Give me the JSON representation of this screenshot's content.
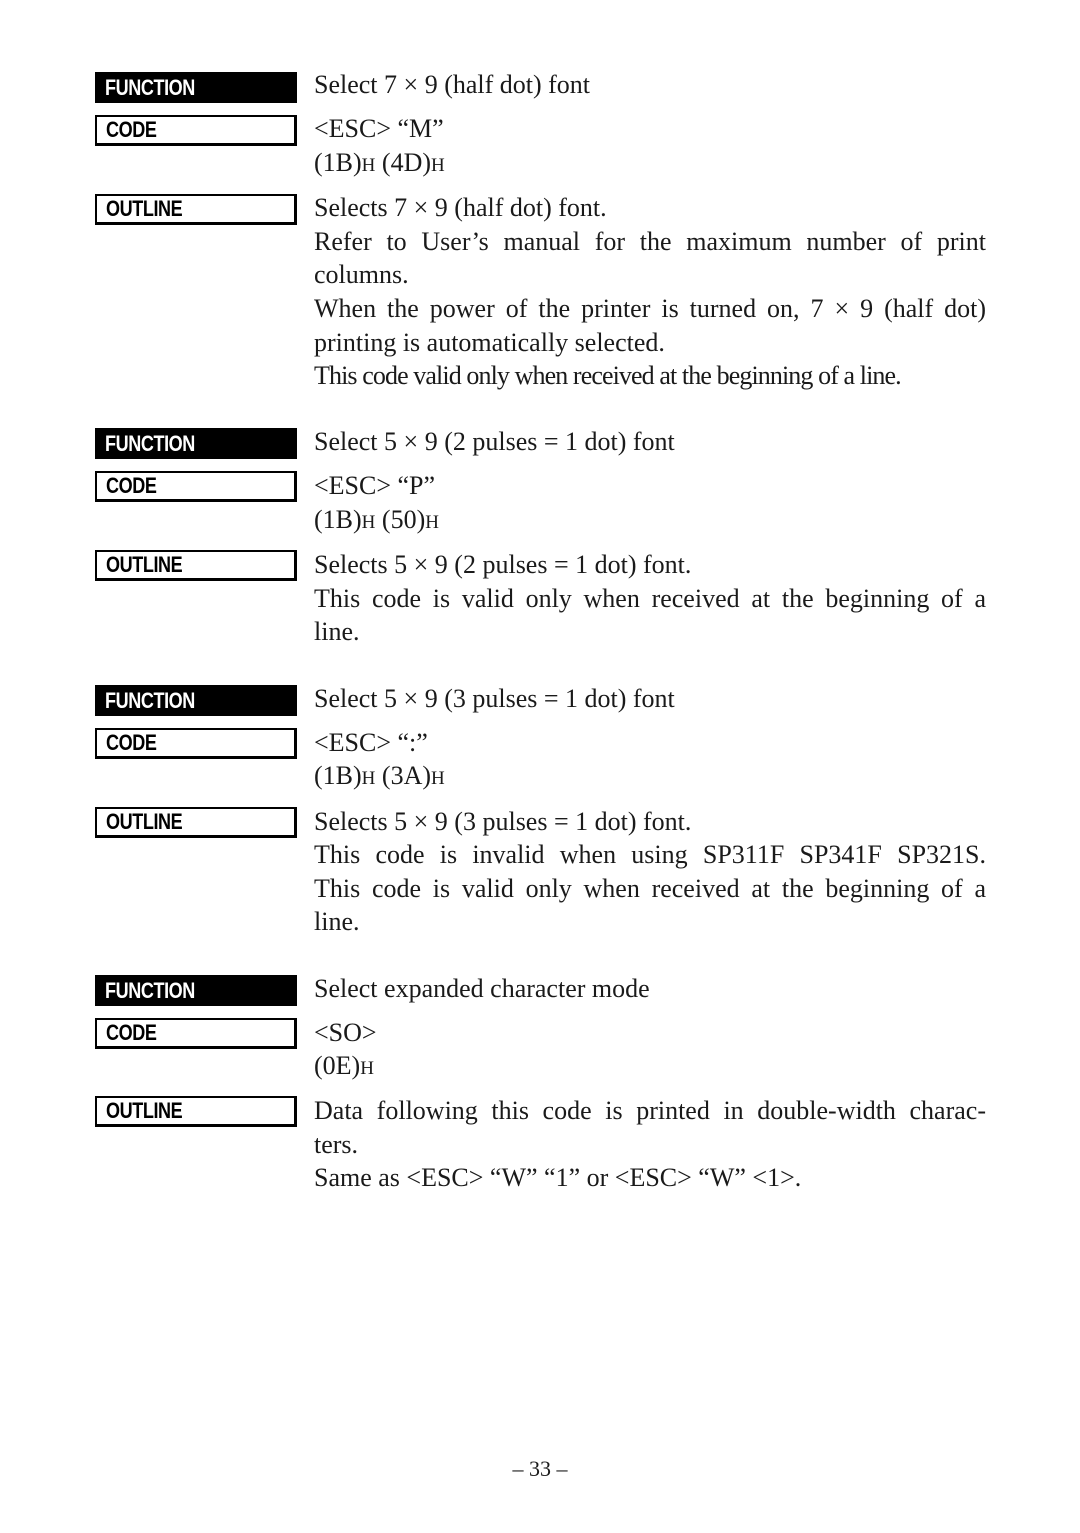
{
  "labels": {
    "function": "FUNCTION",
    "code": "CODE",
    "outline": "OUTLINE"
  },
  "entries": [
    {
      "function": "Select 7 × 9 (half dot) font",
      "code": "<ESC> “M”",
      "hex": [
        "(1B)",
        "H",
        " (4D)",
        "H"
      ],
      "outline": [
        "Selects 7 × 9 (half dot) font.",
        "Refer to User’s manual for the maximum number of print",
        "columns.",
        "When the power of the printer is turned on, 7 × 9 (half dot)",
        "printing is automatically selected.",
        "This code valid only when received at the beginning of a line."
      ]
    },
    {
      "function": "Select 5 × 9 (2 pulses = 1 dot) font",
      "code": "<ESC> “P”",
      "hex": [
        "(1B)",
        "H",
        " (50)",
        "H"
      ],
      "outline": [
        "Selects 5 × 9 (2 pulses = 1 dot) font.",
        "This code is valid only when received at the beginning of a",
        "line."
      ]
    },
    {
      "function": "Select 5 × 9 (3 pulses = 1 dot) font",
      "code": "<ESC> “:”",
      "hex": [
        "(1B)",
        "H",
        " (3A)",
        "H"
      ],
      "outline": [
        "Selects 5 × 9 (3 pulses = 1 dot) font.",
        "This code is invalid when using SP311F SP341F SP321S.",
        "This code is valid only when received at the beginning of a",
        "line."
      ]
    },
    {
      "function": "Select expanded character mode",
      "code": "<SO>",
      "hex": [
        "(0E)",
        "H"
      ],
      "outline": [
        "Data following this code is printed in double-width charac-",
        "ters.",
        "Same as <ESC> “W” “1” or <ESC> “W” <1>."
      ]
    }
  ],
  "page_number": "– 33 –"
}
